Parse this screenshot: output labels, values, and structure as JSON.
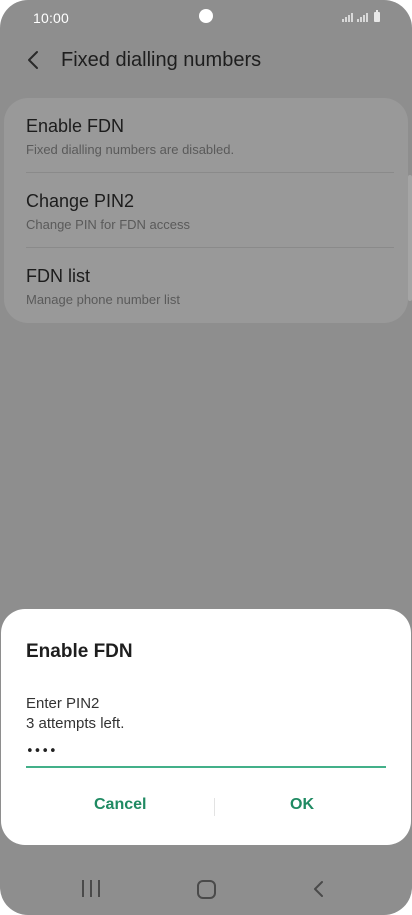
{
  "status_bar": {
    "time": "10:00",
    "icons": [
      "camera-cutout",
      "signal-icon",
      "signal-icon",
      "battery-icon"
    ]
  },
  "header": {
    "back_icon": "chevron-left-icon",
    "title": "Fixed dialling numbers"
  },
  "settings": {
    "items": [
      {
        "title": "Enable FDN",
        "subtitle": "Fixed dialling numbers are disabled."
      },
      {
        "title": "Change PIN2",
        "subtitle": "Change PIN for FDN access"
      },
      {
        "title": "FDN list",
        "subtitle": "Manage phone number list"
      }
    ]
  },
  "dialog": {
    "title": "Enable FDN",
    "line1": "Enter PIN2",
    "line2": "3 attempts left.",
    "pin_value": "••••",
    "cancel_label": "Cancel",
    "ok_label": "OK"
  },
  "navbar": {
    "icons": [
      "recents-icon",
      "home-icon",
      "back-icon"
    ]
  },
  "colors": {
    "accent": "#1f8a62",
    "input_underline": "#43b089",
    "scrim": "#8e8e8e",
    "dialog_bg": "#ffffff"
  }
}
